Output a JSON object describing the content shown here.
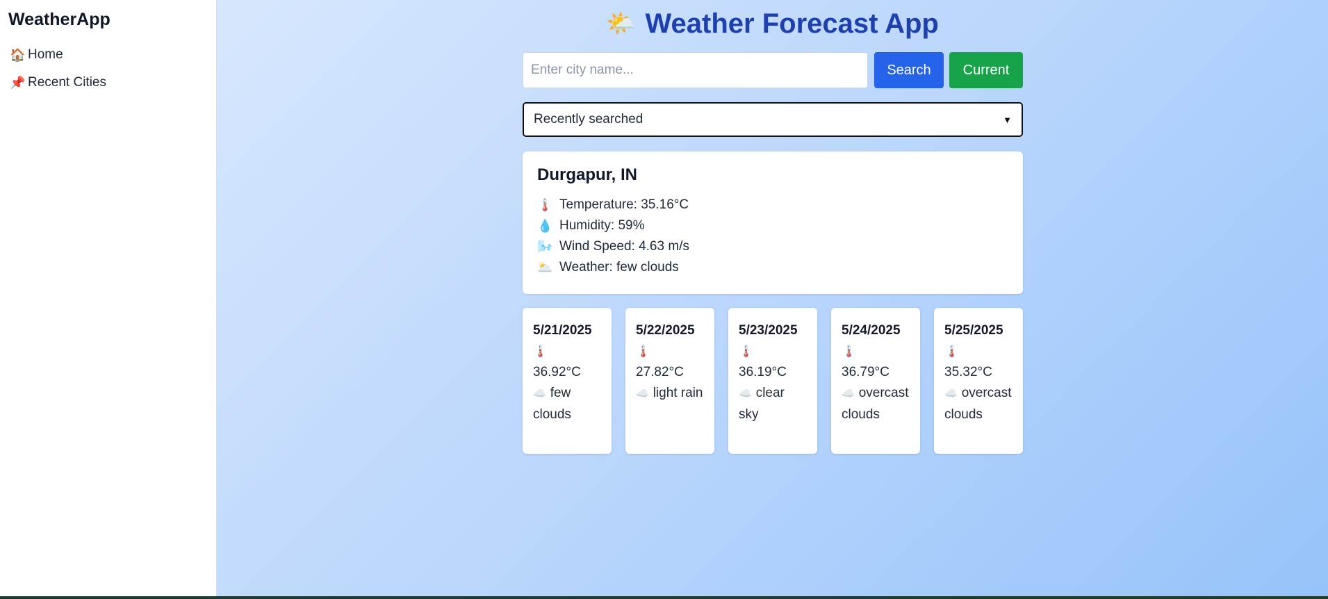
{
  "sidebar": {
    "brand": "WeatherApp",
    "items": [
      {
        "icon": "house-icon",
        "glyph": "🏠",
        "label": "Home"
      },
      {
        "icon": "pushpin-icon",
        "glyph": "📌",
        "label": "Recent Cities"
      }
    ]
  },
  "header": {
    "icon": "sun-behind-cloud-icon",
    "glyph": "🌤️",
    "title": "Weather Forecast App"
  },
  "search": {
    "placeholder": "Enter city name...",
    "value": "",
    "search_label": "Search",
    "current_label": "Current"
  },
  "recent": {
    "selected": "Recently searched"
  },
  "current": {
    "city": "Durgapur, IN",
    "stats": [
      {
        "icon": "thermometer-icon",
        "glyph": "🌡️",
        "text": "Temperature: 35.16°C"
      },
      {
        "icon": "droplet-icon",
        "glyph": "💧",
        "text": "Humidity: 59%"
      },
      {
        "icon": "wind-icon",
        "glyph": "🌬️",
        "text": "Wind Speed: 4.63 m/s"
      },
      {
        "icon": "sun-behind-cloud-icon",
        "glyph": "🌥️",
        "text": "Weather: few clouds"
      }
    ]
  },
  "forecast": [
    {
      "date": "5/21/2025",
      "temp": "36.92°C",
      "desc": "few clouds"
    },
    {
      "date": "5/22/2025",
      "temp": "27.82°C",
      "desc": "light rain"
    },
    {
      "date": "5/23/2025",
      "temp": "36.19°C",
      "desc": "clear sky"
    },
    {
      "date": "5/24/2025",
      "temp": "36.79°C",
      "desc": "overcast clouds"
    },
    {
      "date": "5/25/2025",
      "temp": "35.32°C",
      "desc": "overcast clouds"
    }
  ],
  "forecast_glyphs": {
    "thermometer": "🌡️",
    "cloud": "☁️"
  },
  "colors": {
    "title": "#1e40af",
    "search_button": "#2563eb",
    "current_button": "#16a34a",
    "background_start": "#d7e7fd",
    "background_end": "#96c3fa"
  }
}
